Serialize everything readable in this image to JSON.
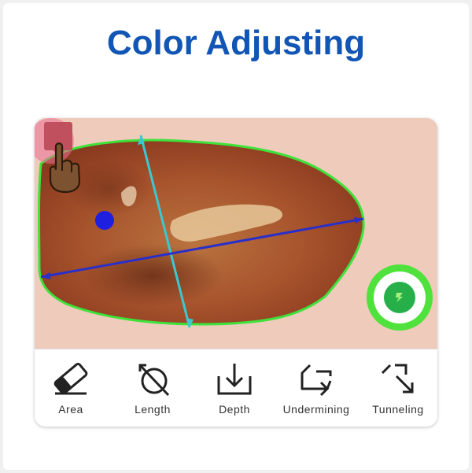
{
  "header": {
    "title": "Color Adjusting"
  },
  "toolbar": {
    "tools": [
      {
        "label": "Area",
        "icon": "eraser-icon"
      },
      {
        "label": "Length",
        "icon": "ruler-circle-icon"
      },
      {
        "label": "Depth",
        "icon": "download-arrow-icon"
      },
      {
        "label": "Undermining",
        "icon": "loop-arrow-icon"
      },
      {
        "label": "Tunneling",
        "icon": "tunnel-arrow-icon"
      }
    ]
  },
  "colors": {
    "title": "#1155b5",
    "wound_outline": "#3ee23a",
    "length_line": "#39c9d1",
    "width_line": "#2a2fc9",
    "marker_dot": "#1f1fe0",
    "fab": "#4fe23c"
  }
}
